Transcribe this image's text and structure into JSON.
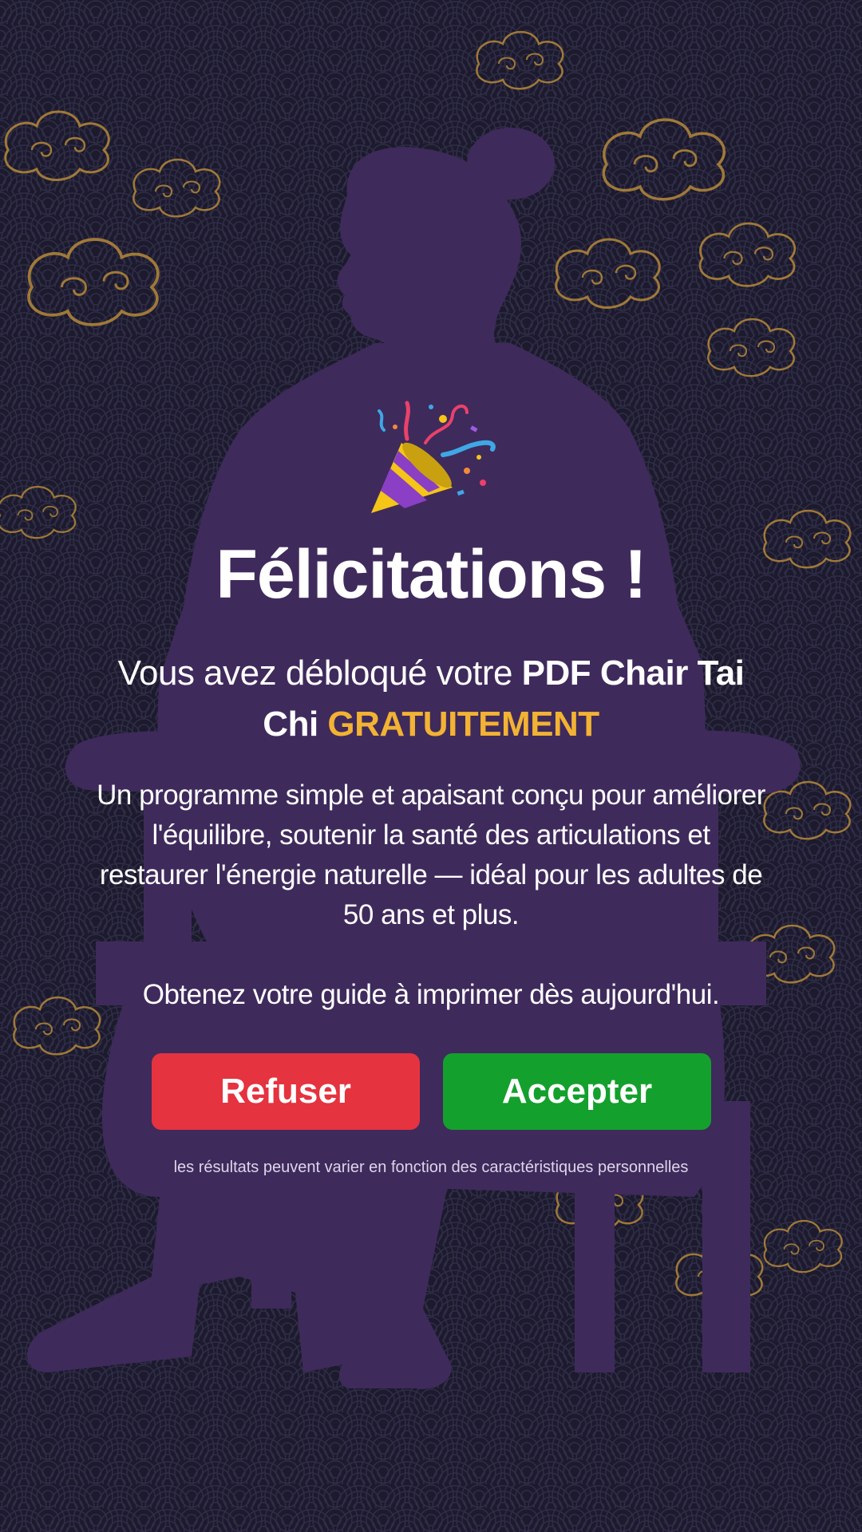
{
  "colors": {
    "background": "#1c1a2c",
    "silhouette": "#3f2a5c",
    "pattern_line": "#2c2a42",
    "cloud_gold": "#b78a3a",
    "accent_gold": "#f2b233",
    "refuse_red": "#e5333f",
    "accept_green": "#14a02d"
  },
  "icons": {
    "celebration": "party-popper-icon"
  },
  "header": {
    "title": "Félicitations !"
  },
  "offer": {
    "line_prefix": "Vous avez débloqué votre ",
    "product_name": "PDF Chair Tai Chi",
    "highlight": "GRATUITEMENT"
  },
  "description": "Un programme simple et apaisant conçu pour améliorer l'équilibre, soutenir la santé des articulations et restaurer l'énergie naturelle — idéal pour les adultes de 50 ans et plus.",
  "cta_text": "Obtenez votre guide à imprimer dès aujourd'hui.",
  "buttons": {
    "refuse_label": "Refuser",
    "accept_label": "Accepter"
  },
  "disclaimer": "les résultats peuvent varier en fonction des caractéristiques personnelles"
}
